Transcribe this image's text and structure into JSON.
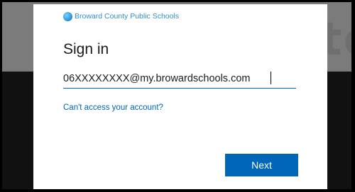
{
  "brand": {
    "name": "Broward County Public Schools"
  },
  "signin": {
    "title": "Sign in",
    "email_value": "06XXXXXXXX@my.browardschools.com",
    "cant_access_link": "Can't access your account?",
    "next_label": "Next"
  },
  "background": {
    "partial_text": "to"
  },
  "colors": {
    "accent": "#0067b8",
    "brand_text": "#2e8fd0"
  }
}
